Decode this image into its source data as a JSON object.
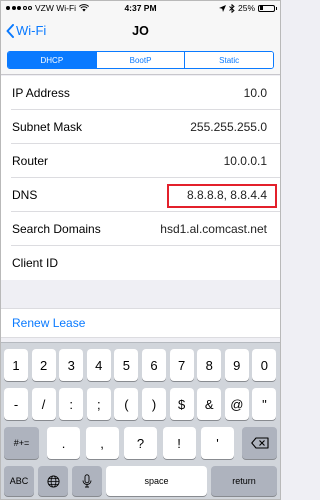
{
  "status": {
    "carrier": "VZW Wi-Fi",
    "time": "4:37 PM",
    "battery": "25%",
    "battery_level": 0.25
  },
  "nav": {
    "back_label": "Wi-Fi",
    "title": "JO"
  },
  "segments": [
    "DHCP",
    "BootP",
    "Static"
  ],
  "selected_segment": "DHCP",
  "rows": [
    {
      "label": "IP Address",
      "value": "10.0"
    },
    {
      "label": "Subnet Mask",
      "value": "255.255.255.0"
    },
    {
      "label": "Router",
      "value": "10.0.0.1"
    },
    {
      "label": "DNS",
      "value": "8.8.8.8,  8.8.4.4"
    },
    {
      "label": "Search Domains",
      "value": "hsd1.al.comcast.net"
    },
    {
      "label": "Client ID",
      "value": ""
    }
  ],
  "renew_label": "Renew Lease",
  "keyboard": {
    "row1": [
      "1",
      "2",
      "3",
      "4",
      "5",
      "6",
      "7",
      "8",
      "9",
      "0"
    ],
    "row2": [
      "-",
      "/",
      ":",
      ";",
      "(",
      ")",
      "$",
      "&",
      "@",
      "\""
    ],
    "row3": [
      ".",
      ",",
      "?",
      "!",
      "'"
    ],
    "shift_label": "#+=",
    "abc_label": "ABC",
    "space_label": "space",
    "return_label": "return"
  },
  "accent_color": "#0a7aff",
  "highlight_color": "#e3202b"
}
